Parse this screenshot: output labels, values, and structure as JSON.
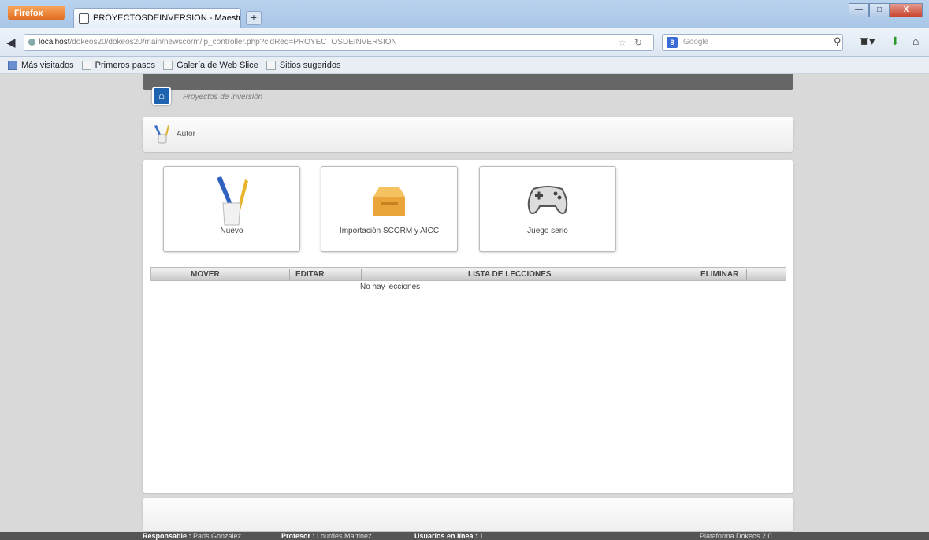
{
  "browser": {
    "menu_label": "Firefox",
    "tab_title": "PROYECTOSDEINVERSION - Maestría en ...",
    "newtab_label": "+",
    "win_min": "—",
    "win_max": "□",
    "win_close": "X",
    "url_host": "localhost",
    "url_path": "/dokeos20/dokeos20/main/newscorm/lp_controller.php?cidReq=PROYECTOSDEINVERSION",
    "search_placeholder": "Google",
    "search_engine_letter": "8"
  },
  "bookmarks": [
    "Más visitados",
    "Primeros pasos",
    "Galería de Web Slice",
    "Sitios sugeridos"
  ],
  "breadcrumb": "Proyectos de inversión",
  "section_title": "Autor",
  "cards": [
    {
      "label": "Nuevo",
      "icon": "pen-cup-icon"
    },
    {
      "label": "Importación SCORM y AICC",
      "icon": "box-icon"
    },
    {
      "label": "Juego serio",
      "icon": "gamepad-icon"
    }
  ],
  "table": {
    "headers": [
      "MOVER",
      "EDITAR",
      "LISTA DE LECCIONES",
      "ELIMINAR"
    ],
    "empty_message": "No hay lecciones"
  },
  "footer": {
    "responsable_label": "Responsable :",
    "responsable_value": "Paris Gonzalez",
    "profesor_label": "Profesor :",
    "profesor_value": "Lourdes Martinez",
    "usuarios_label": "Usuarios en línea :",
    "usuarios_value": "1",
    "platform": "Plataforma Dokeos 2.0"
  },
  "colors": {
    "home_blue": "#1e63b0",
    "firefox_orange": "#e0691d",
    "page_bg": "#d9d9d9"
  }
}
